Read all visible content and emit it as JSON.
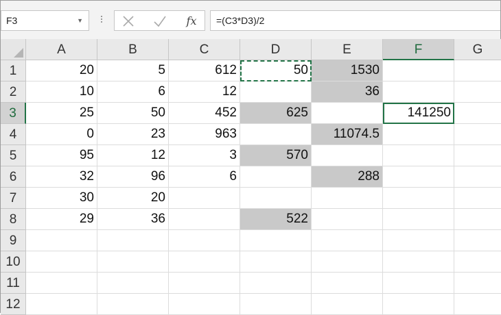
{
  "name_box": {
    "value": "F3"
  },
  "formula_bar": {
    "cancel_icon": "x-icon",
    "enter_icon": "check-icon",
    "fx_label": "fx",
    "formula": "=(C3*D3)/2"
  },
  "columns": [
    "A",
    "B",
    "C",
    "D",
    "E",
    "F",
    "G"
  ],
  "rows": [
    "1",
    "2",
    "3",
    "4",
    "5",
    "6",
    "7",
    "8",
    "9",
    "10",
    "11",
    "12"
  ],
  "cells": [
    [
      "20",
      "5",
      "612",
      "50",
      "1530",
      "",
      ""
    ],
    [
      "10",
      "6",
      "12",
      "",
      "36",
      "",
      ""
    ],
    [
      "25",
      "50",
      "452",
      "625",
      "",
      "141250",
      ""
    ],
    [
      "0",
      "23",
      "963",
      "",
      "11074.5",
      "",
      ""
    ],
    [
      "95",
      "12",
      "3",
      "570",
      "",
      "",
      ""
    ],
    [
      "32",
      "96",
      "6",
      "",
      "288",
      "",
      ""
    ],
    [
      "30",
      "20",
      "",
      "",
      "",
      "",
      ""
    ],
    [
      "29",
      "36",
      "",
      "522",
      "",
      "",
      ""
    ],
    [
      "",
      "",
      "",
      "",
      "",
      "",
      ""
    ],
    [
      "",
      "",
      "",
      "",
      "",
      "",
      ""
    ],
    [
      "",
      "",
      "",
      "",
      "",
      "",
      ""
    ],
    [
      "",
      "",
      "",
      "",
      "",
      "",
      ""
    ]
  ],
  "highlighted_cells": [
    "E1",
    "E2",
    "D3",
    "E4",
    "D5",
    "E6",
    "D8"
  ],
  "active_cell": "F3",
  "copy_marquee": "D1",
  "selected_column": "F",
  "selected_row": "3",
  "colors": {
    "accent": "#217346",
    "highlight_fill": "#c9c9c9",
    "header_fill": "#e9e9e9"
  }
}
